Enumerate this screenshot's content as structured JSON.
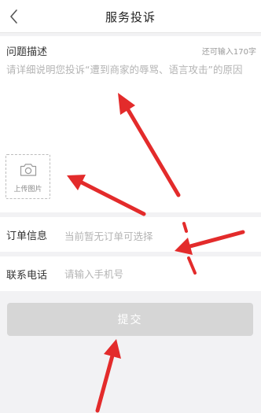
{
  "navbar": {
    "title": "服务投诉",
    "back_icon": "chevron-left-icon"
  },
  "problem": {
    "label": "问题描述",
    "remaining": "还可输入170字",
    "placeholder": "请详细说明您投诉“遭到商家的辱骂、语言攻击”的原因",
    "value": "",
    "upload_label": "上传图片",
    "upload_icon": "camera-icon"
  },
  "order": {
    "label": "订单信息",
    "value": "当前暂无订单可选择"
  },
  "phone": {
    "label": "联系电话",
    "placeholder": "请输入手机号",
    "value": ""
  },
  "submit": {
    "label": "提交",
    "enabled": false
  },
  "colors": {
    "background": "#f2f2f4",
    "card": "#ffffff",
    "placeholder": "#b4b4b4",
    "button_disabled": "#d6d6d6",
    "annotation_arrow": "#e32b2b"
  }
}
